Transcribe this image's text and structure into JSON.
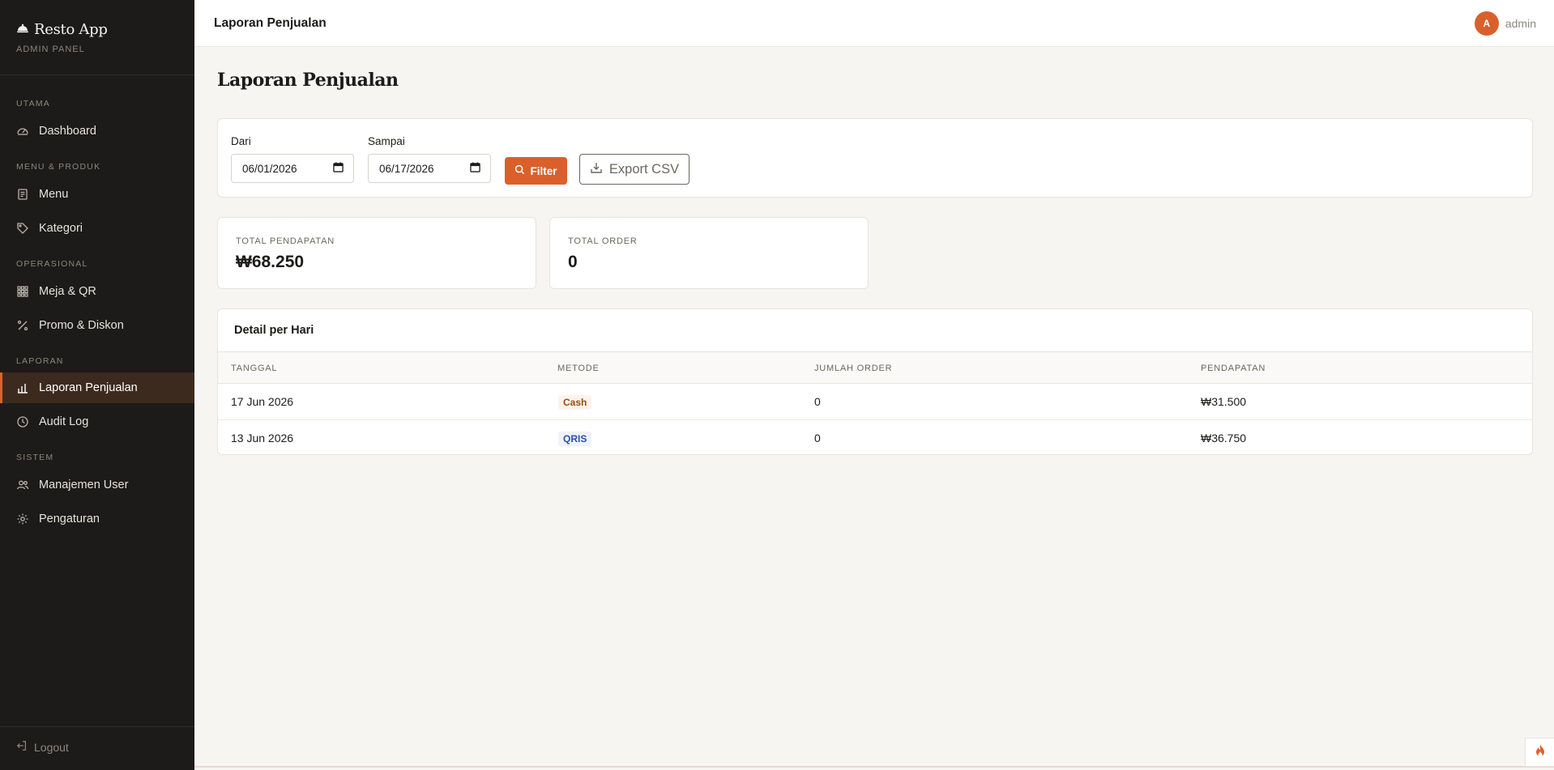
{
  "brand": {
    "title": "Resto App",
    "subtitle": "ADMIN PANEL"
  },
  "sidebar": {
    "sections": {
      "utama": "UTAMA",
      "menu_produk": "MENU & PRODUK",
      "operasional": "OPERASIONAL",
      "laporan": "LAPORAN",
      "sistem": "SISTEM"
    },
    "items": {
      "dashboard": "Dashboard",
      "menu": "Menu",
      "kategori": "Kategori",
      "meja_qr": "Meja & QR",
      "promo": "Promo & Diskon",
      "laporan": "Laporan Penjualan",
      "audit": "Audit Log",
      "users": "Manajemen User",
      "settings": "Pengaturan"
    },
    "active": "Laporan Penjualan",
    "logout": "Logout"
  },
  "topbar": {
    "title": "Laporan Penjualan",
    "avatar_initial": "A",
    "username": "admin"
  },
  "page": {
    "title": "Laporan Penjualan"
  },
  "filter": {
    "from_label": "Dari",
    "from_value": "06/01/2026",
    "to_label": "Sampai",
    "to_value": "06/17/2026",
    "filter_button": "Filter",
    "export_button": "Export CSV"
  },
  "stats": {
    "total_revenue_label": "TOTAL PENDAPATAN",
    "total_revenue_value": "₩68.250",
    "total_order_label": "TOTAL ORDER",
    "total_order_value": "0"
  },
  "table": {
    "title": "Detail per Hari",
    "headers": [
      "TANGGAL",
      "METODE",
      "JUMLAH ORDER",
      "PENDAPATAN"
    ],
    "rows": [
      {
        "date": "17 Jun 2026",
        "method": "Cash",
        "orders": "0",
        "revenue": "₩31.500"
      },
      {
        "date": "13 Jun 2026",
        "method": "QRIS",
        "orders": "0",
        "revenue": "₩36.750"
      }
    ]
  },
  "colors": {
    "accent": "#d9602b",
    "sidebar_bg": "#1c1b19",
    "page_bg": "#f6f5f2"
  }
}
